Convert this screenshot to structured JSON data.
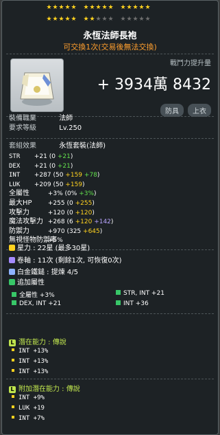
{
  "stars": {
    "row1_filled": 15,
    "row1_total": 15,
    "row2_filled": 7,
    "row2_total": 15
  },
  "item": {
    "name": "永恆法師長袍",
    "trade_note": "可交換1次(交易後無法交換)",
    "icon": "robe-icon"
  },
  "combat_power": {
    "label": "戰鬥力提升量",
    "value": "+ 3934萬 8432",
    "tags": [
      "防具",
      "上衣"
    ]
  },
  "requirements": {
    "job_label": "裝備職業",
    "job_value": "法師",
    "level_label": "要求等級",
    "level_value": "Lv.250"
  },
  "set_effect": {
    "label": "套組效果",
    "value": "永恆套裝(法師)"
  },
  "stats": [
    {
      "name": "STR",
      "total": "+21",
      "base": "(0",
      "extra": "+21",
      "extra2": "",
      "close": ")"
    },
    {
      "name": "DEX",
      "total": "+21",
      "base": "(0",
      "extra": "+21",
      "extra2": "",
      "close": ")"
    },
    {
      "name": "INT",
      "total": "+287",
      "base": "(50",
      "extra": "+159",
      "extra2": "+78",
      "close": ")"
    },
    {
      "name": "LUK",
      "total": "+209",
      "base": "(50",
      "extra": "+159",
      "extra2": "",
      "close": ")"
    },
    {
      "name": "全屬性",
      "total": "+3%",
      "base": "(0%",
      "extra": "+3%",
      "extra2": "",
      "close": ")"
    },
    {
      "name": "最大HP",
      "total": "+255",
      "base": "(0",
      "extra": "+255",
      "extra2": "",
      "close": ")"
    },
    {
      "name": "攻擊力",
      "total": "+120",
      "base": "(0",
      "extra": "+120",
      "extra2": "",
      "close": ")"
    },
    {
      "name": "魔法攻擊力",
      "total": "+268",
      "base": "(6",
      "extra": "+120",
      "extra2": "+142",
      "close": ")"
    },
    {
      "name": "防禦力",
      "total": "+970",
      "base": "(325",
      "extra": "+645",
      "extra2": "",
      "close": ")"
    },
    {
      "name": "無視怪物防禦率",
      "total": "+5%",
      "base": "",
      "extra": "",
      "extra2": "",
      "close": ""
    }
  ],
  "enhance": {
    "star_force": "星力 : 22星 (最多30星)",
    "scroll": "卷軸 : 11次 (剩餘1次, 可恢復0次)",
    "platinum_hammer": "白金鐵鎚 : 提煉 4/5",
    "add_option_label": "追加屬性",
    "add_options": [
      "全屬性 +3%",
      "STR, INT +21",
      "DEX, INT +21",
      "INT +36"
    ]
  },
  "potential": {
    "label": "潛在能力 : 傳說",
    "badge": "L",
    "lines": [
      "INT +13%",
      "INT +13%",
      "INT +13%"
    ]
  },
  "bonus_potential": {
    "label": "附加潛在能力 : 傳說",
    "badge": "L",
    "lines": [
      "INT +9%",
      "LUK +19",
      "INT +7%"
    ]
  },
  "colors": {
    "star": "#ffd21f",
    "trade_note": "#ff9f2e",
    "green": "#63e04d",
    "yellow": "#ffd21f",
    "purple": "#b9a5ff",
    "legend": "#c0e54e"
  }
}
